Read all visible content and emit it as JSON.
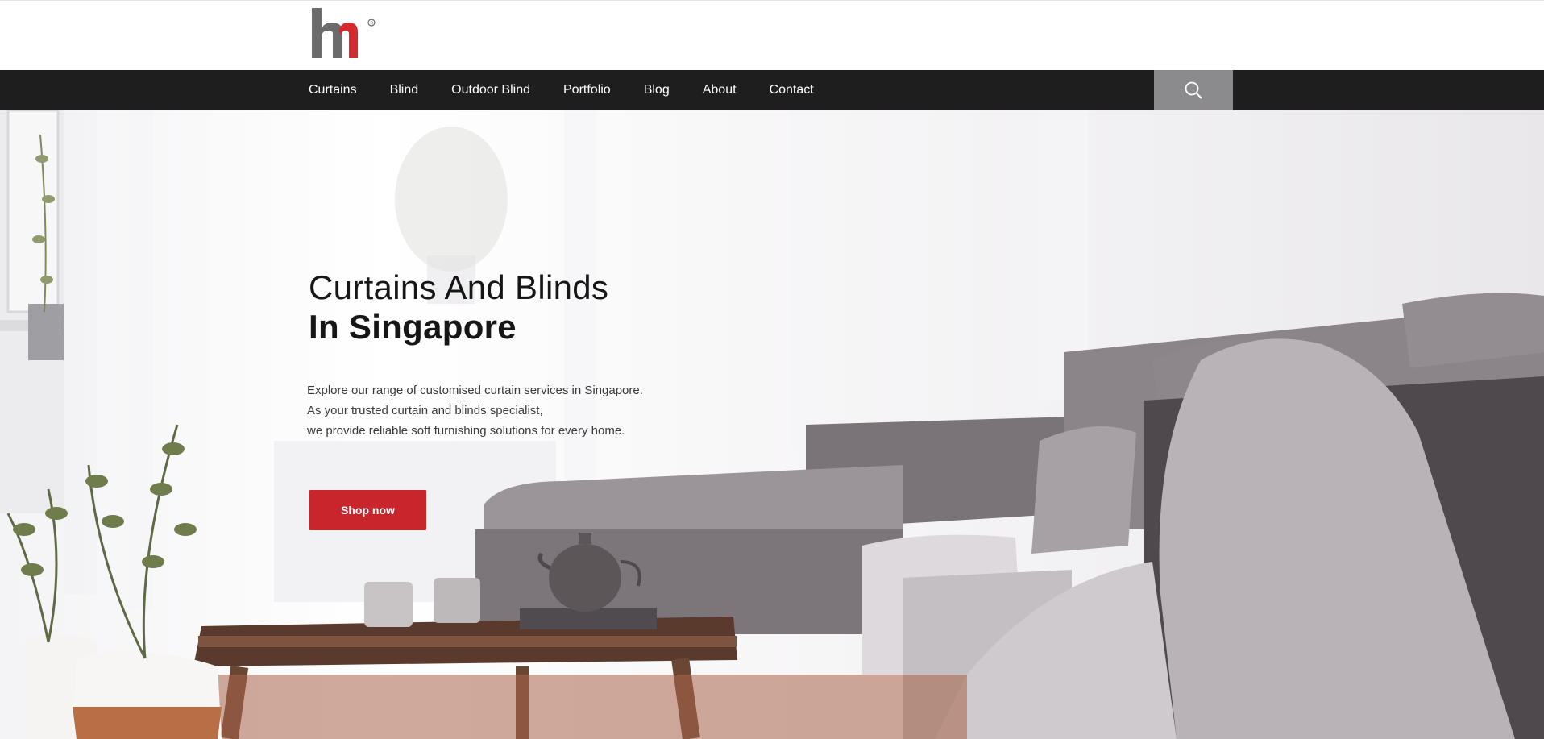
{
  "brand": {
    "logo_name": "hm-logo",
    "accent": "#c8262c"
  },
  "nav": {
    "items": [
      "Curtains",
      "Blind",
      "Outdoor Blind",
      "Portfolio",
      "Blog",
      "About",
      "Contact"
    ]
  },
  "search": {
    "icon": "search-icon"
  },
  "hero": {
    "title_line1": "Curtains And Blinds",
    "title_line2": "In Singapore",
    "description": [
      "Explore our range of customised curtain services in Singapore.",
      "As your trusted curtain and blinds specialist,",
      "we provide reliable soft furnishing solutions for every home."
    ],
    "cta_label": "Shop now"
  },
  "colors": {
    "nav_bg": "#1e1e1e",
    "search_bg": "#8b8b8d",
    "cta_bg": "#c8262c"
  }
}
